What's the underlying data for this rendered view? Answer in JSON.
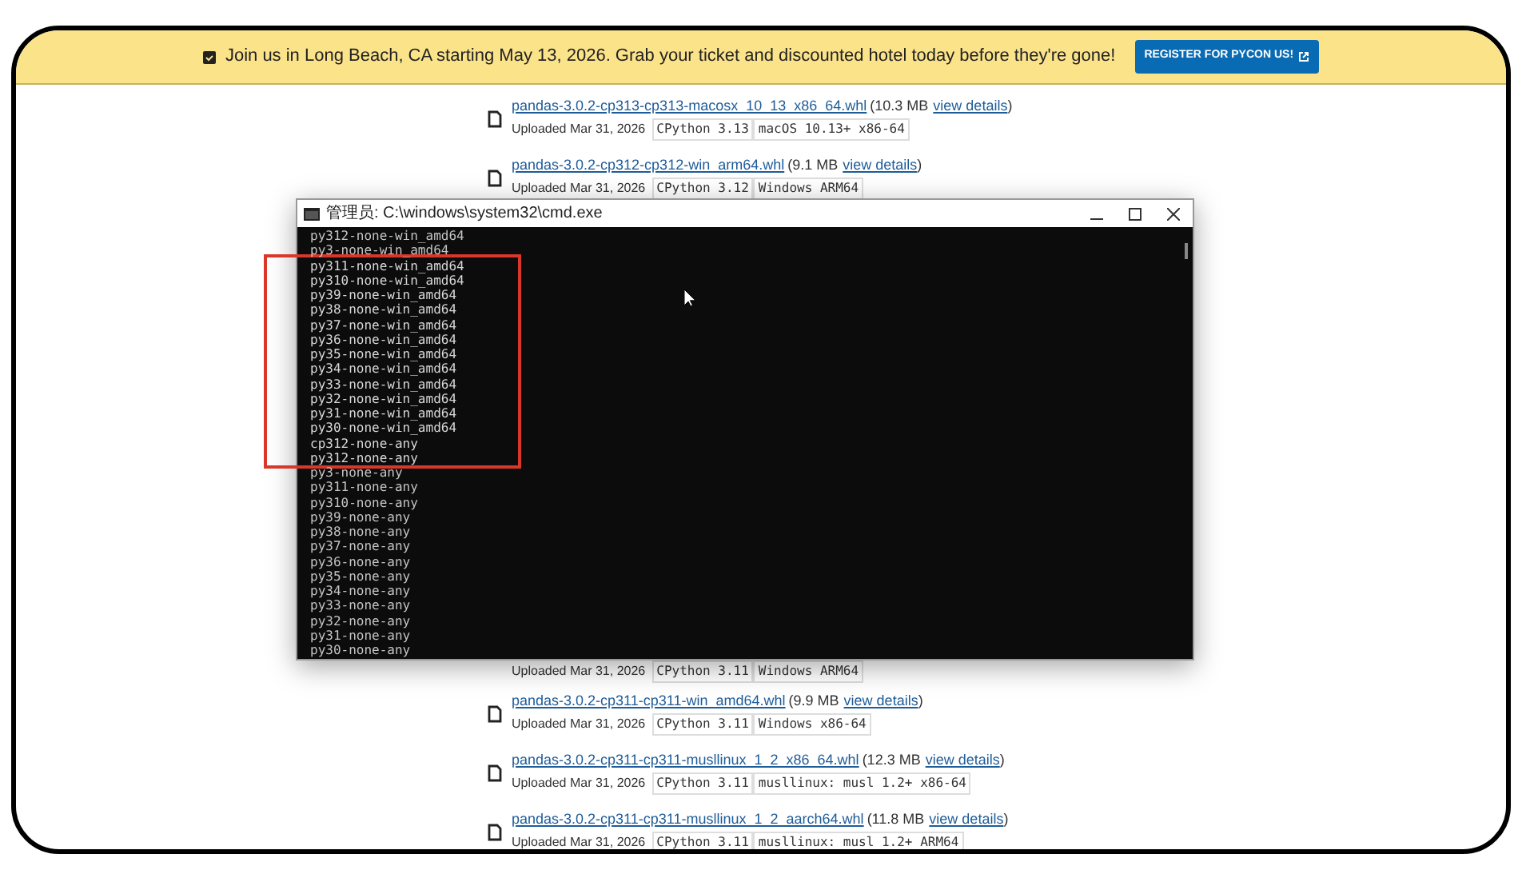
{
  "banner": {
    "message": "Join us in Long Beach, CA starting May 13, 2026. Grab your ticket and discounted hotel today before they're gone!",
    "button": "REGISTER FOR PYCON US!"
  },
  "files": [
    {
      "kind": "full",
      "name": "pandas-3.0.2-cp313-cp313-macosx_10_13_x86_64.whl",
      "size": "(10.3 MB",
      "link": "view details",
      "close": ")",
      "uploaded": "Uploaded Mar 31, 2026",
      "tags": [
        "CPython 3.13",
        "macOS 10.13+ x86-64"
      ]
    },
    {
      "kind": "full",
      "name": "pandas-3.0.2-cp312-cp312-win_arm64.whl",
      "size": "(9.1 MB",
      "link": "view details",
      "close": ")",
      "uploaded": "Uploaded Mar 31, 2026",
      "tags": [
        "CPython 3.12",
        "Windows ARM64"
      ]
    },
    {
      "kind": "gap"
    },
    {
      "kind": "details",
      "uploaded": "Uploaded Mar 31, 2026",
      "tags": [
        "CPython 3.11",
        "Windows ARM64"
      ]
    },
    {
      "kind": "full",
      "name": "pandas-3.0.2-cp311-cp311-win_amd64.whl",
      "size": "(9.9 MB",
      "link": "view details",
      "close": ")",
      "uploaded": "Uploaded Mar 31, 2026",
      "tags": [
        "CPython 3.11",
        "Windows x86-64"
      ]
    },
    {
      "kind": "full",
      "name": "pandas-3.0.2-cp311-cp311-musllinux_1_2_x86_64.whl",
      "size": "(12.3 MB",
      "link": "view details",
      "close": ")",
      "uploaded": "Uploaded Mar 31, 2026",
      "tags": [
        "CPython 3.11",
        "musllinux: musl 1.2+ x86-64"
      ]
    },
    {
      "kind": "full",
      "name": "pandas-3.0.2-cp311-cp311-musllinux_1_2_aarch64.whl",
      "size": "(11.8 MB",
      "link": "view details",
      "close": ")",
      "uploaded": "Uploaded Mar 31, 2026",
      "tags": [
        "CPython 3.11",
        "musllinux: musl 1.2+ ARM64"
      ]
    }
  ],
  "console": {
    "title": "管理员: C:\\windows\\system32\\cmd.exe",
    "lines": [
      {
        "text": "py312-none-win_amd64",
        "highlighted": false
      },
      {
        "text": "py3-none-win_amd64",
        "highlighted": false
      },
      {
        "text": "py311-none-win_amd64",
        "highlighted": true
      },
      {
        "text": "py310-none-win_amd64",
        "highlighted": true
      },
      {
        "text": "py39-none-win_amd64",
        "highlighted": true
      },
      {
        "text": "py38-none-win_amd64",
        "highlighted": true
      },
      {
        "text": "py37-none-win_amd64",
        "highlighted": true
      },
      {
        "text": "py36-none-win_amd64",
        "highlighted": true
      },
      {
        "text": "py35-none-win_amd64",
        "highlighted": true
      },
      {
        "text": "py34-none-win_amd64",
        "highlighted": true
      },
      {
        "text": "py33-none-win_amd64",
        "highlighted": true
      },
      {
        "text": "py32-none-win_amd64",
        "highlighted": true
      },
      {
        "text": "py31-none-win_amd64",
        "highlighted": true
      },
      {
        "text": "py30-none-win_amd64",
        "highlighted": true
      },
      {
        "text": "cp312-none-any",
        "highlighted": true
      },
      {
        "text": "py312-none-any",
        "highlighted": true
      },
      {
        "text": "py3-none-any",
        "highlighted": false
      },
      {
        "text": "py311-none-any",
        "highlighted": false
      },
      {
        "text": "py310-none-any",
        "highlighted": false
      },
      {
        "text": "py39-none-any",
        "highlighted": false
      },
      {
        "text": "py38-none-any",
        "highlighted": false
      },
      {
        "text": "py37-none-any",
        "highlighted": false
      },
      {
        "text": "py36-none-any",
        "highlighted": false
      },
      {
        "text": "py35-none-any",
        "highlighted": false
      },
      {
        "text": "py34-none-any",
        "highlighted": false
      },
      {
        "text": "py33-none-any",
        "highlighted": false
      },
      {
        "text": "py32-none-any",
        "highlighted": false
      },
      {
        "text": "py31-none-any",
        "highlighted": false
      },
      {
        "text": "py30-none-any",
        "highlighted": false
      }
    ]
  }
}
